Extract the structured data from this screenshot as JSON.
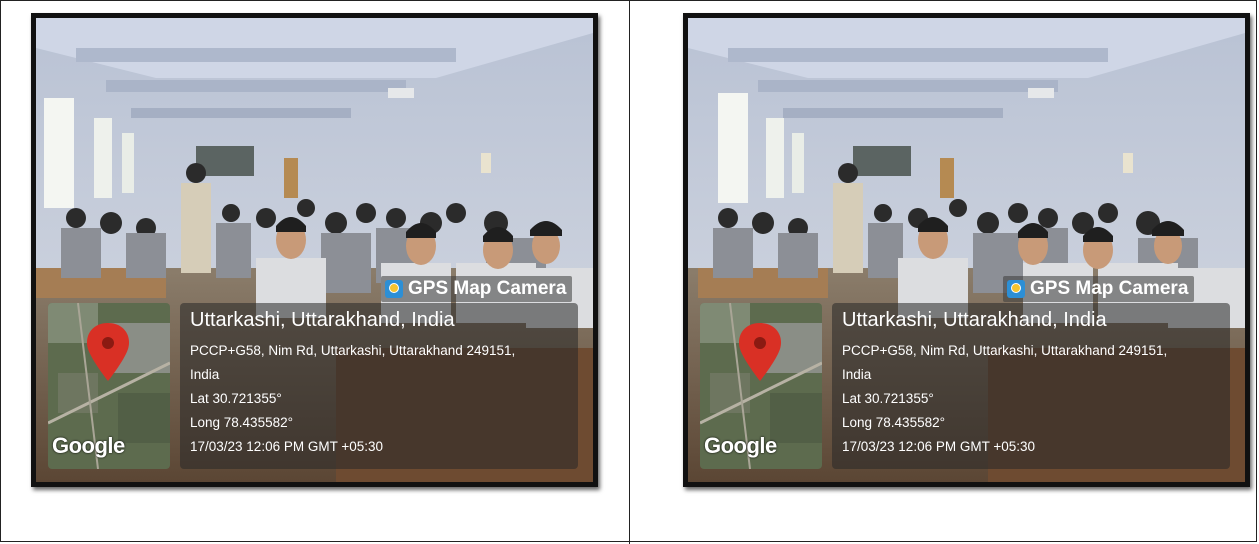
{
  "photos": [
    {
      "app_label": "GPS Map Camera",
      "app_icon": "gps-map-camera-icon",
      "map_watermark": "Google",
      "location_title": "Uttarkashi, Uttarakhand, India",
      "address_line1": "PCCP+G58, Nim Rd, Uttarkashi, Uttarakhand 249151,",
      "address_line2": "India",
      "latitude": "Lat 30.721355°",
      "longitude": "Long 78.435582°",
      "timestamp": "17/03/23 12:06 PM GMT +05:30"
    },
    {
      "app_label": "GPS Map Camera",
      "app_icon": "gps-map-camera-icon",
      "map_watermark": "Google",
      "location_title": "Uttarkashi, Uttarakhand, India",
      "address_line1": "PCCP+G58, Nim Rd, Uttarkashi, Uttarakhand 249151,",
      "address_line2": "India",
      "latitude": "Lat 30.721355°",
      "longitude": "Long 78.435582°",
      "timestamp": "17/03/23 12:06 PM GMT +05:30"
    }
  ],
  "colors": {
    "frame": "#111111",
    "pin": "#d93025",
    "wall": "#c9ced8",
    "uniform": "#8c8f96"
  }
}
